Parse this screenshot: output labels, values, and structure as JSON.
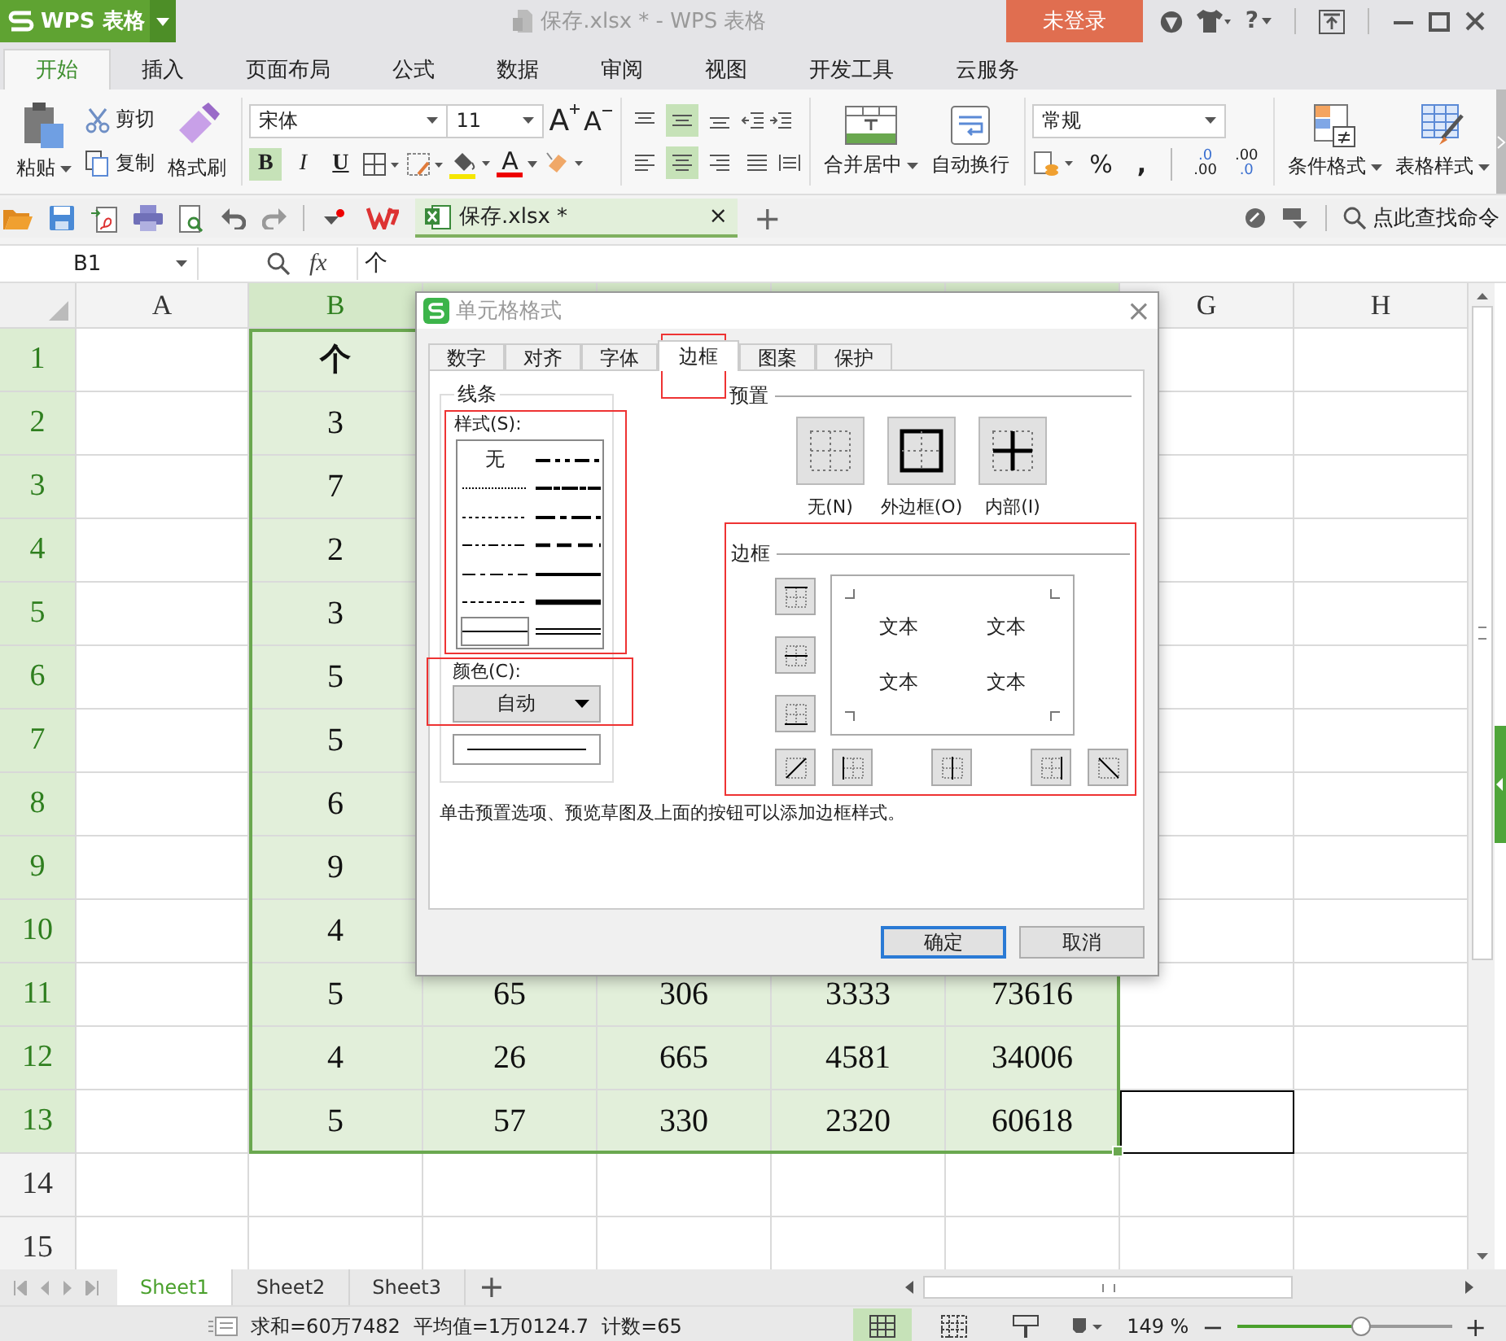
{
  "app": {
    "logo": "WPS 表格",
    "title": "保存.xlsx * - WPS 表格",
    "login": "未登录",
    "help": "?"
  },
  "menu_tabs": [
    {
      "label": "开始",
      "selected": true
    },
    {
      "label": "插入",
      "selected": false
    },
    {
      "label": "页面布局",
      "selected": false
    },
    {
      "label": "公式",
      "selected": false
    },
    {
      "label": "数据",
      "selected": false
    },
    {
      "label": "审阅",
      "selected": false
    },
    {
      "label": "视图",
      "selected": false
    },
    {
      "label": "开发工具",
      "selected": false
    },
    {
      "label": "云服务",
      "selected": false
    }
  ],
  "ribbon": {
    "paste": "粘贴",
    "cut": "剪切",
    "copy": "复制",
    "format_painter": "格式刷",
    "font": "宋体",
    "font_size": "11",
    "size_buttons": [
      "A",
      "A"
    ],
    "styles": [
      {
        "label": "B",
        "selected": true
      },
      {
        "label": "I",
        "selected": false
      },
      {
        "label": "U",
        "selected": false
      }
    ],
    "font_color": "A",
    "vertical_align": [
      {
        "kind": "top",
        "selected": false
      },
      {
        "kind": "middle",
        "selected": true
      },
      {
        "kind": "bottom",
        "selected": false
      }
    ],
    "horizontal_align": [
      {
        "kind": "left",
        "selected": false
      },
      {
        "kind": "center",
        "selected": true
      },
      {
        "kind": "right",
        "selected": false
      },
      {
        "kind": "justify",
        "selected": false
      }
    ],
    "merge": "合并居中",
    "wrap": "自动换行",
    "number_format": "常规",
    "percent": "%",
    "comma": ",",
    "decimals": [
      {
        "top": ".0",
        "bottom": ".00"
      },
      {
        "top": ".00",
        "bottom": ".0"
      }
    ],
    "conditional": "条件格式",
    "table_style": "表格样式"
  },
  "quick_bar": {
    "document_tab": "保存.xlsx *",
    "close": "×",
    "new_tab": "+",
    "search": "点此查找命令"
  },
  "formula_bar": {
    "name_box": "B1",
    "fx": "fx",
    "value": "个"
  },
  "sheet": {
    "columns": [
      {
        "label": "A",
        "selected": false
      },
      {
        "label": "B",
        "selected": true
      },
      {
        "selected": true
      },
      {
        "selected": true
      },
      {
        "selected": true
      },
      {
        "selected": true
      },
      {
        "label": "G",
        "selected": false
      },
      {
        "label": "H",
        "selected": false
      }
    ],
    "rows": [
      {
        "number": "1",
        "selected": true,
        "bold": true,
        "cells": {
          "B": "个"
        }
      },
      {
        "number": "2",
        "selected": true,
        "cells": {
          "B": "3"
        }
      },
      {
        "number": "3",
        "selected": true,
        "cells": {
          "B": "7"
        }
      },
      {
        "number": "4",
        "selected": true,
        "cells": {
          "B": "2"
        }
      },
      {
        "number": "5",
        "selected": true,
        "cells": {
          "B": "3"
        }
      },
      {
        "number": "6",
        "selected": true,
        "cells": {
          "B": "5"
        }
      },
      {
        "number": "7",
        "selected": true,
        "cells": {
          "B": "5"
        }
      },
      {
        "number": "8",
        "selected": true,
        "cells": {
          "B": "6"
        }
      },
      {
        "number": "9",
        "selected": true,
        "cells": {
          "B": "9"
        }
      },
      {
        "number": "10",
        "selected": true,
        "cells": {
          "B": "4"
        }
      },
      {
        "number": "11",
        "selected": true,
        "cells": {
          "B": "5",
          "C": "65",
          "D": "306",
          "E": "3333",
          "F": "73616"
        }
      },
      {
        "number": "12",
        "selected": true,
        "cells": {
          "B": "4",
          "C": "26",
          "D": "665",
          "E": "4581",
          "F": "34006"
        }
      },
      {
        "number": "13",
        "selected": true,
        "outlined_cells": {
          "G": true
        },
        "cells": {
          "B": "5",
          "C": "57",
          "D": "330",
          "E": "2320",
          "F": "60618"
        }
      },
      {
        "number": "14",
        "selected": false,
        "cells": {}
      },
      {
        "number": "15",
        "selected": false,
        "cells": {}
      }
    ]
  },
  "sheet_tabs": [
    {
      "label": "Sheet1",
      "selected": true
    },
    {
      "label": "Sheet2",
      "selected": false
    },
    {
      "label": "Sheet3",
      "selected": false
    }
  ],
  "add_sheet": "+",
  "status_bar": {
    "sum": "求和=60万7482",
    "average": "平均值=1万0124.7",
    "count": "计数=65",
    "view_modes": [
      {
        "kind": "normal",
        "selected": true
      },
      {
        "kind": "page",
        "selected": false
      },
      {
        "kind": "split",
        "selected": false
      }
    ],
    "zoom": "149 %",
    "zoom_out": "−",
    "zoom_in": "+",
    "slider": {
      "level": 0.58
    }
  },
  "dialog": {
    "title": "单元格格式",
    "close": "×",
    "tabs": [
      {
        "label": "数字",
        "selected": false
      },
      {
        "label": "对齐",
        "selected": false
      },
      {
        "label": "字体",
        "selected": false
      },
      {
        "label": "边框",
        "selected": true
      },
      {
        "label": "图案",
        "selected": false
      },
      {
        "label": "保护",
        "selected": false
      }
    ],
    "line_group": "线条",
    "style_label": "样式(S):",
    "line_styles": [
      {
        "kind": "none",
        "label": "无",
        "selected": false
      },
      {
        "kind": "medium-dash-dot-dot",
        "selected": false
      },
      {
        "kind": "hair",
        "selected": false
      },
      {
        "kind": "slant-dash-dot",
        "selected": false
      },
      {
        "kind": "dotted",
        "selected": false
      },
      {
        "kind": "medium-dash-dot",
        "selected": false
      },
      {
        "kind": "dash-dot-dot",
        "selected": false
      },
      {
        "kind": "medium-dashed",
        "selected": false
      },
      {
        "kind": "dash-dot",
        "selected": false
      },
      {
        "kind": "medium",
        "selected": false
      },
      {
        "kind": "dashed",
        "selected": false
      },
      {
        "kind": "thick",
        "selected": false
      },
      {
        "kind": "thin",
        "selected": true
      },
      {
        "kind": "double",
        "selected": false
      }
    ],
    "color_label": "颜色(C):",
    "color_value": "自动",
    "preset_label": "预置",
    "presets": [
      {
        "kind": "none",
        "label": "无(N)"
      },
      {
        "kind": "outline",
        "label": "外边框(O)"
      },
      {
        "kind": "inside",
        "label": "内部(I)"
      }
    ],
    "border_label": "边框",
    "preview_texts": [
      "文本",
      "文本",
      "文本",
      "文本"
    ],
    "side_buttons": [
      {
        "kind": "top"
      },
      {
        "kind": "middle"
      },
      {
        "kind": "bottom"
      }
    ],
    "bottom_buttons": [
      {
        "kind": "diag-up"
      },
      {
        "kind": "left"
      },
      {
        "kind": "center"
      },
      {
        "kind": "right"
      },
      {
        "kind": "diag-down"
      }
    ],
    "hint": "单击预置选项、预览草图及上面的按钮可以添加边框样式。",
    "ok": "确定",
    "cancel": "取消"
  }
}
